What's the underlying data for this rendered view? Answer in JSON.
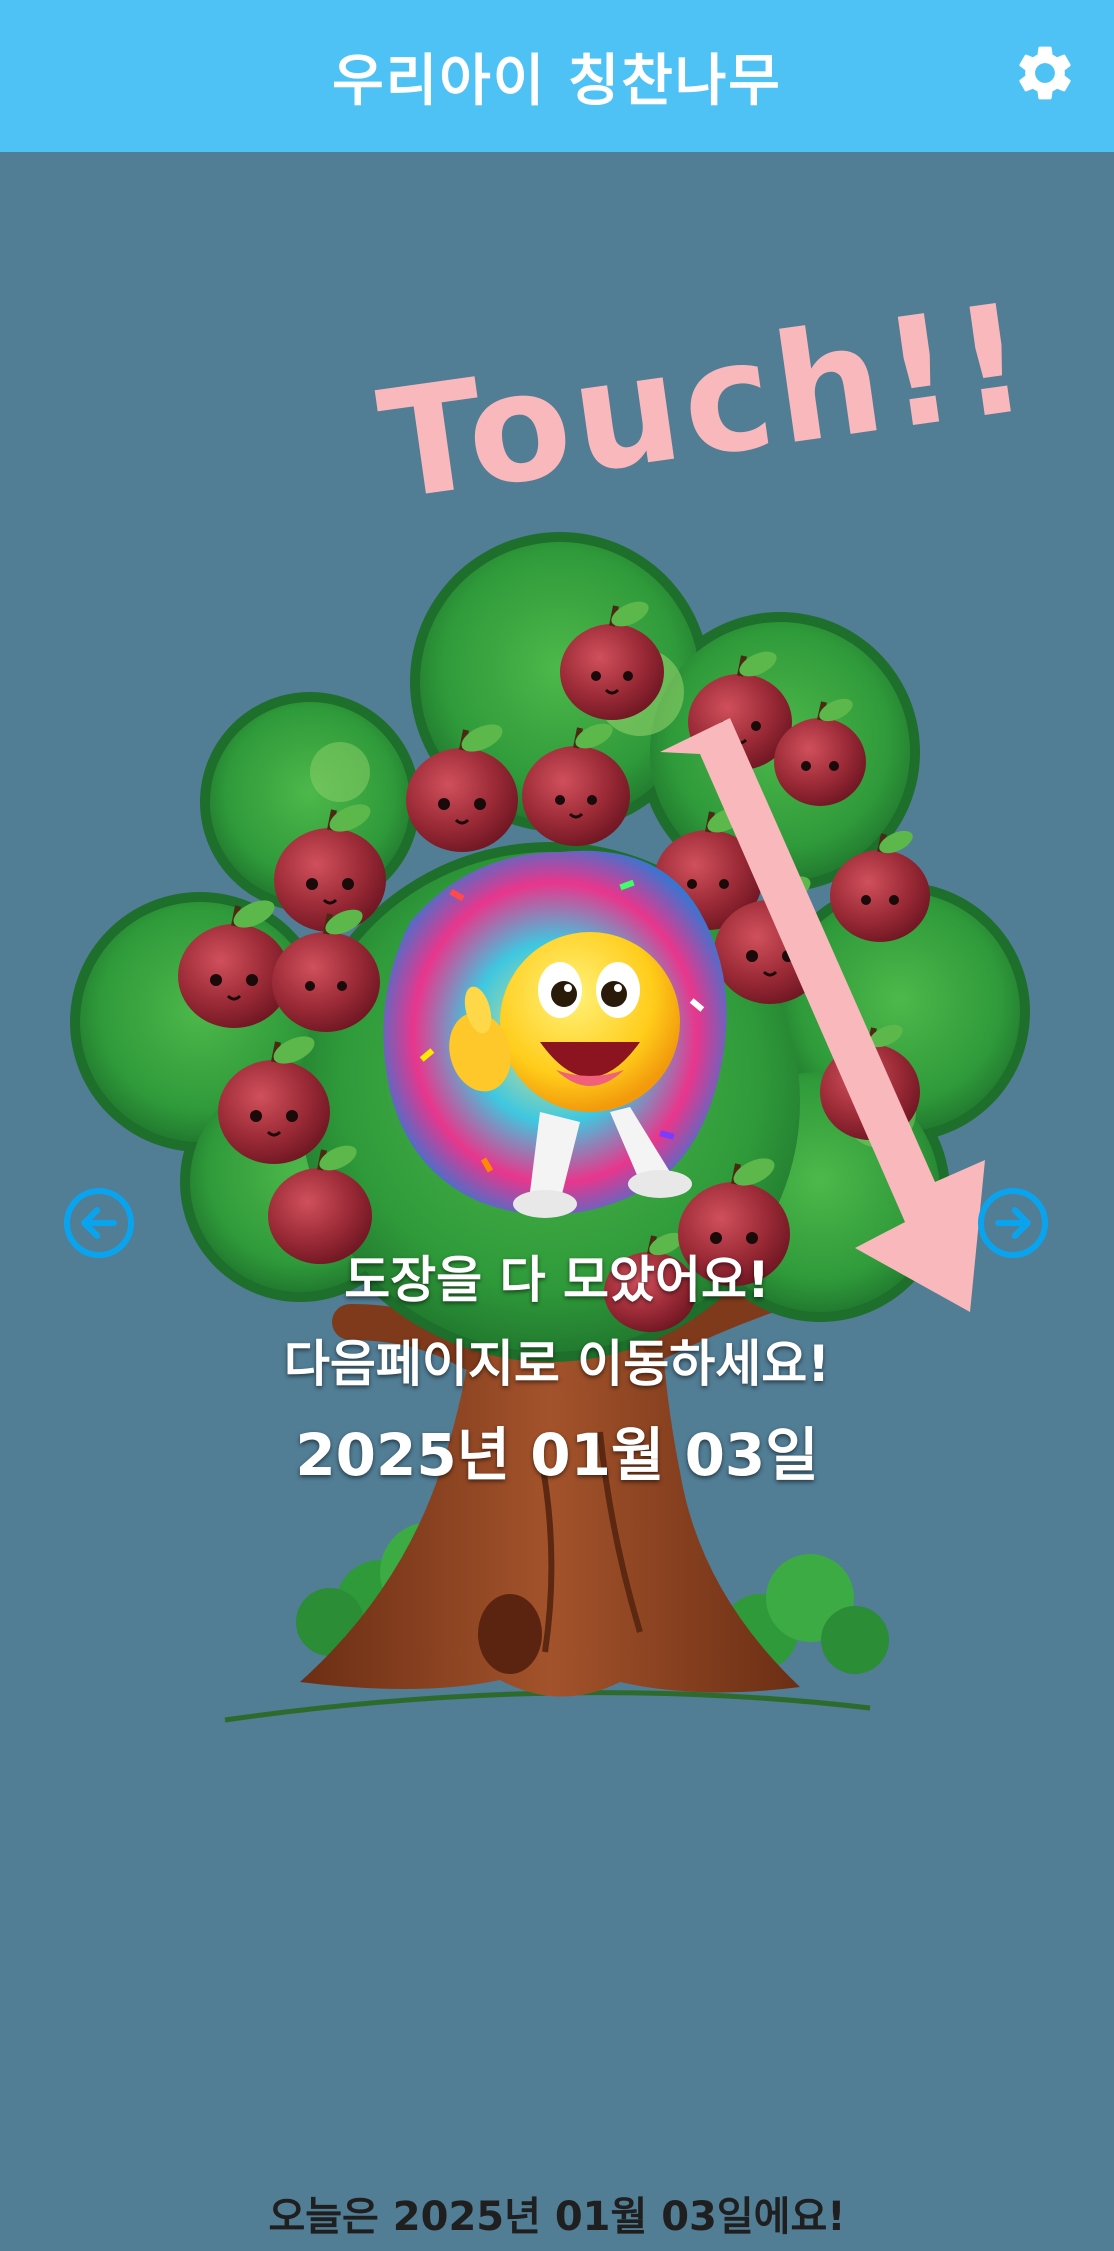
{
  "app": {
    "title": "우리아이 칭찬나무",
    "settings_icon": "gear-icon"
  },
  "overlay": {
    "touch_label": "Touch!!"
  },
  "message": {
    "line1": "도장을 다 모았어요!",
    "line2": "다음페이지로 이동하세요!",
    "date": "2025년 01월 03일"
  },
  "navigation": {
    "prev_icon": "arrow-left-icon",
    "next_icon": "arrow-right-icon"
  },
  "footer": {
    "today": "오늘은 2025년 01월 03일에요!"
  },
  "colors": {
    "appbar": "#4fc2f5",
    "background": "#517d95",
    "touch_text": "#f9b8bb",
    "nav_button": "#0aa4ee"
  }
}
